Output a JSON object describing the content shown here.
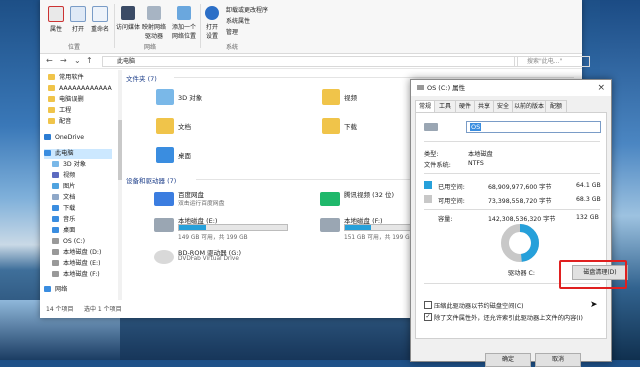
{
  "ribbon": {
    "buttons": [
      {
        "label": "属性"
      },
      {
        "label": "打开"
      },
      {
        "label": "重命名"
      },
      {
        "label": "访问媒体"
      },
      {
        "label": "映射网络\n驱动器"
      },
      {
        "label": "添加一个\n网络位置"
      },
      {
        "label": "打开\n设置"
      }
    ],
    "small_items": [
      "卸载或更改程序",
      "系统属性",
      "管理"
    ],
    "groups": [
      "位置",
      "网络",
      "系统"
    ]
  },
  "address": {
    "path": "此电脑",
    "search_placeholder": "搜索\"此电...\""
  },
  "sidebar": {
    "items": [
      {
        "label": "常用软件",
        "color": "#f0c44a"
      },
      {
        "label": "AAAAAAAAAAAA",
        "color": "#f0c44a"
      },
      {
        "label": "电脑误删",
        "color": "#f0c44a"
      },
      {
        "label": "工程",
        "color": "#f0c44a"
      },
      {
        "label": "配音",
        "color": "#f0c44a"
      },
      {
        "label": "OneDrive",
        "color": "#2b7cd3"
      },
      {
        "label": "此电脑",
        "color": "#3a8de0"
      },
      {
        "label": "3D 对象",
        "color": "#7ab8e8"
      },
      {
        "label": "视频",
        "color": "#5c6bc0"
      },
      {
        "label": "图片",
        "color": "#4fa3e0"
      },
      {
        "label": "文档",
        "color": "#8fa8c8"
      },
      {
        "label": "下载",
        "color": "#3a8de0"
      },
      {
        "label": "音乐",
        "color": "#3a8de0"
      },
      {
        "label": "桌面",
        "color": "#3a8de0"
      },
      {
        "label": "OS (C:)",
        "color": "#999999"
      },
      {
        "label": "本地磁盘 (D:)",
        "color": "#999999"
      },
      {
        "label": "本地磁盘 (E:)",
        "color": "#999999"
      },
      {
        "label": "本地磁盘 (F:)",
        "color": "#999999"
      },
      {
        "label": "网络",
        "color": "#3a8de0"
      }
    ]
  },
  "main": {
    "folders_header": "文件夹 (7)",
    "folders": [
      {
        "label": "3D 对象"
      },
      {
        "label": "视频"
      },
      {
        "label": "文档"
      },
      {
        "label": "下载"
      },
      {
        "label": "桌面"
      }
    ],
    "drives_header": "设备和驱动器 (7)",
    "drives": [
      {
        "name": "百度网盘",
        "sub": "双击运行百度网盘",
        "color": "#3b7de0"
      },
      {
        "name": "腾讯视频 (32 位)",
        "sub": "",
        "color": "#1fb86b"
      },
      {
        "name": "本地磁盘 (E:)",
        "free": "149 GB 可用，共 199 GB",
        "fill": 0.25,
        "color": "#9aa6b3"
      },
      {
        "name": "本地磁盘 (F:)",
        "free": "151 GB 可用，共 199 GB",
        "fill": 0.24,
        "color": "#9aa6b3"
      },
      {
        "name": "BD-ROM 驱动器 (G:)",
        "sub": "DVDFab Virtual Drive",
        "color": "#d9d9d9"
      }
    ]
  },
  "statusbar": {
    "count": "14 个项目",
    "selected": "选中 1 个项目"
  },
  "dialog": {
    "title": "OS (C:) 属性",
    "close": "×",
    "tabs": [
      "常规",
      "工具",
      "硬件",
      "共享",
      "安全",
      "以前的版本",
      "配额"
    ],
    "name_value": "OS",
    "type_label": "类型:",
    "type_value": "本地磁盘",
    "fs_label": "文件系统:",
    "fs_value": "NTFS",
    "used_label": "已用空间:",
    "used_bytes": "68,909,977,600 字节",
    "used_gb": "64.1 GB",
    "free_label": "可用空间:",
    "free_bytes": "73,398,558,720 字节",
    "free_gb": "68.3 GB",
    "cap_label": "容量:",
    "cap_bytes": "142,308,536,320 字节",
    "cap_gb": "132 GB",
    "used_fraction": 0.484,
    "drive_label": "驱动器 C:",
    "cleanup_button": "磁盘清理(D)",
    "compress_label": "压缩此驱动器以节约磁盘空间(C)",
    "index_label": "除了文件属性外，还允许索引此驱动器上文件的内容(I)",
    "ok_button": "确定",
    "cancel_button": "取消",
    "used_color": "#26a0da",
    "free_color": "#c8c8c8"
  }
}
